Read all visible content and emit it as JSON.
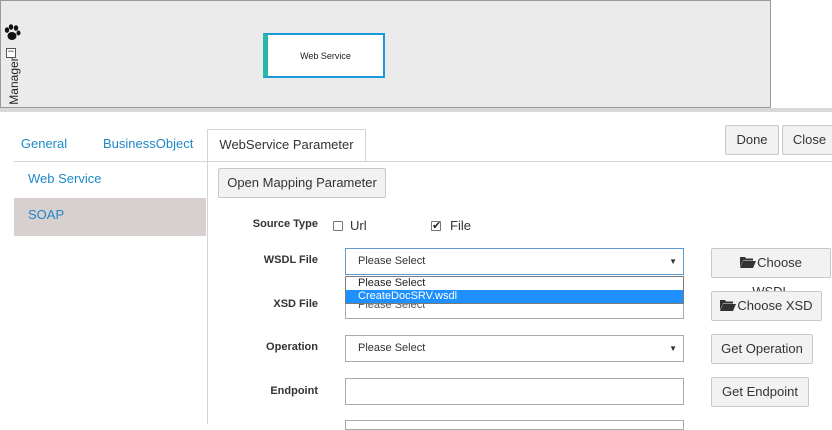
{
  "canvas": {
    "side_label": "Manager",
    "collapse_glyph": "−",
    "node_label": "Web Service",
    "paw_icon": "paw-icon"
  },
  "tabs": [
    {
      "label": "General",
      "active": false
    },
    {
      "label": "BusinessObject",
      "active": false
    },
    {
      "label": "WebService Parameter",
      "active": true
    }
  ],
  "header_buttons": {
    "done": "Done",
    "close": "Close"
  },
  "nav": [
    {
      "label": "Web Service",
      "selected": false
    },
    {
      "label": "SOAP",
      "selected": true
    }
  ],
  "form": {
    "open_mapping": "Open Mapping Parameter",
    "source_type": {
      "label": "Source Type",
      "url_label": "Url",
      "url_checked": false,
      "file_label": "File",
      "file_checked": true,
      "check_glyph": "✔"
    },
    "wsdl": {
      "label": "WSDL File",
      "value": "Please Select",
      "options": [
        "Please Select",
        "CreateDocSRV.wsdl"
      ],
      "highlighted": "CreateDocSRV.wsdl",
      "button": "Choose WSDL"
    },
    "xsd": {
      "label": "XSD File",
      "value": "Please Select",
      "button": "Choose XSD"
    },
    "operation": {
      "label": "Operation",
      "value": "Please Select",
      "button": "Get Operation"
    },
    "endpoint": {
      "label": "Endpoint",
      "value": "",
      "button": "Get Endpoint"
    }
  },
  "colors": {
    "link": "#1e88c9",
    "nav_selected_bg": "#d8cfcf",
    "highlight": "#1e90ff",
    "node_border": "#1a9bd7",
    "node_accent": "#2ab8a6"
  }
}
